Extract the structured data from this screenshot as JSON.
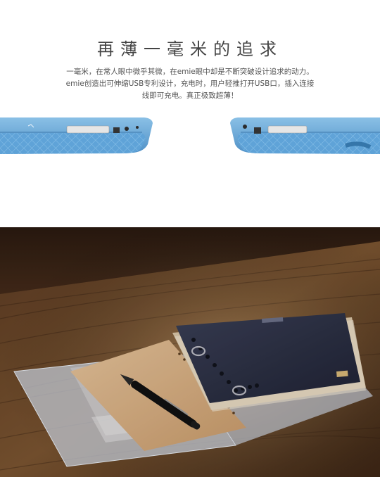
{
  "header": {
    "title": "再薄一毫米的追求",
    "description_line1": "一毫米，在常人眼中微乎其微，在emie眼中却是不断突破设计追求的动力。",
    "description_line2": "emie创造出可伸缩USB专利设计，充电时，用户轻推打开USB口，插入连接",
    "description_line3": "线即可充电。真正极致超薄！"
  },
  "colors": {
    "device_blue": "#5fa3d8",
    "wood_dark": "#3a2417",
    "notebook_cover": "#2d3247",
    "kraft_paper": "#d9b48a"
  }
}
